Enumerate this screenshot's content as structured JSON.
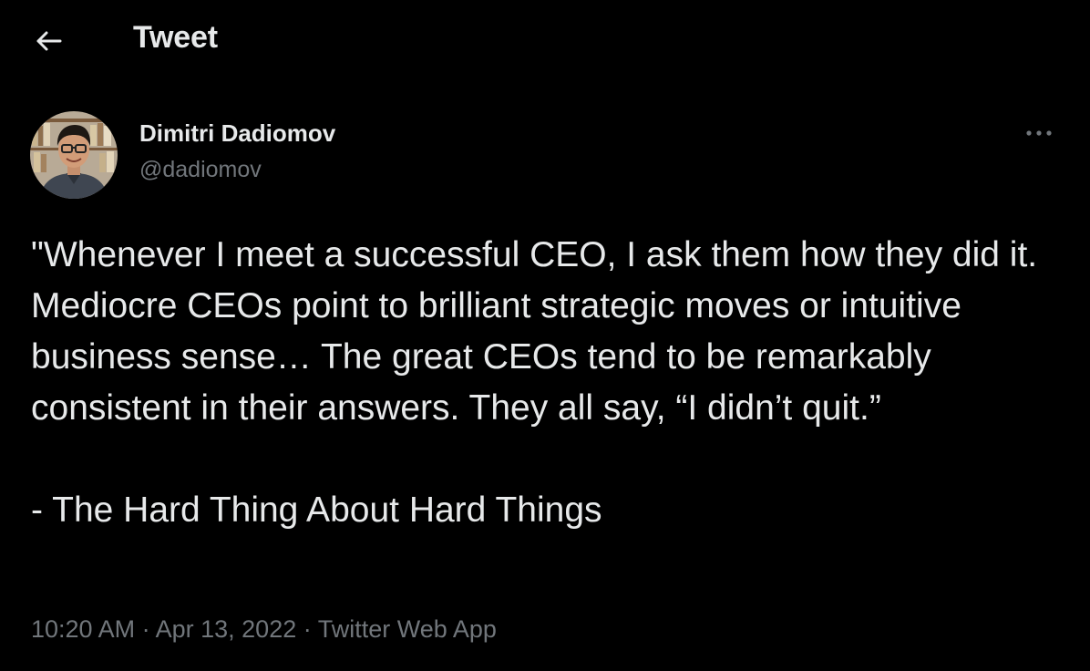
{
  "header": {
    "back_icon": "arrow-left-icon",
    "title": "Tweet"
  },
  "tweet": {
    "author": {
      "display_name": "Dimitri Dadiomov",
      "handle": "@dadiomov"
    },
    "more_icon": "more-horizontal-icon",
    "text_main": "\"Whenever I meet a successful CEO, I ask them how they did it. Mediocre CEOs point to brilliant strategic moves or intuitive business sense… The great CEOs tend to be remarkably consistent in their answers. They all say, “I didn’t quit.”",
    "text_source": "- The Hard Thing About Hard Things",
    "time": "10:20 AM",
    "separator": "·",
    "date": "Apr 13, 2022",
    "source_app": "Twitter Web App"
  },
  "colors": {
    "background": "#000000",
    "primary_text": "#e7e9ea",
    "secondary_text": "#71767b"
  }
}
